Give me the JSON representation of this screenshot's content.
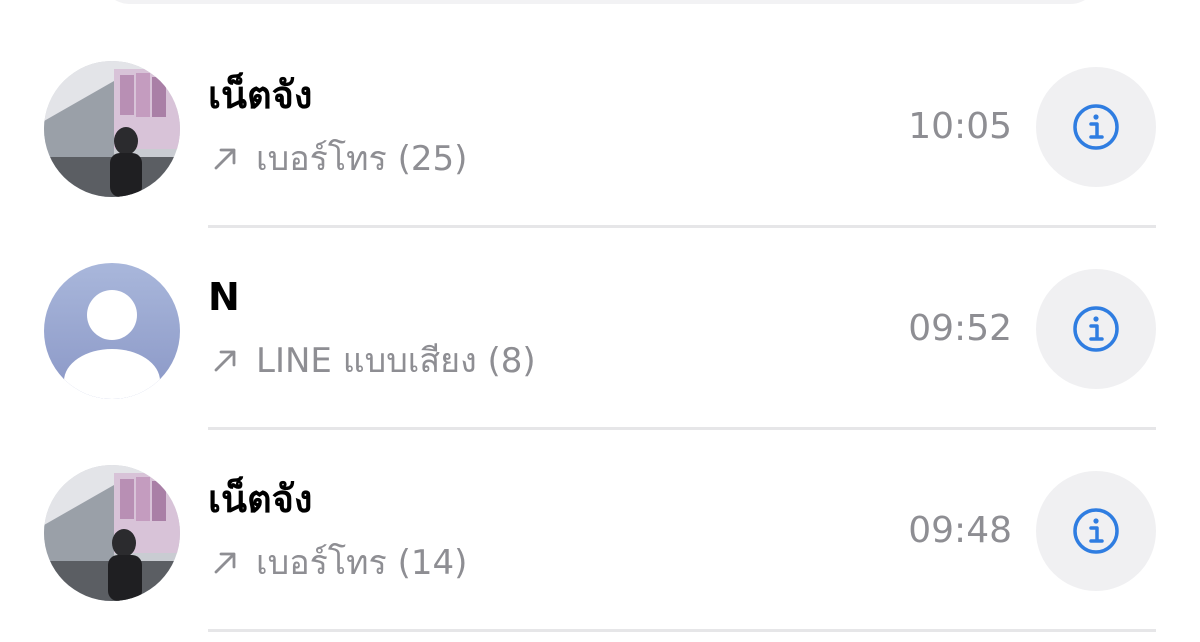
{
  "calls": [
    {
      "name": "เน็ตจัง",
      "call_type": "เบอร์โทร (25)",
      "time": "10:05",
      "avatar": "photo",
      "direction_icon": "outgoing-arrow-icon"
    },
    {
      "name": "N",
      "call_type": "LINE แบบเสียง (8)",
      "time": "09:52",
      "avatar": "placeholder",
      "direction_icon": "outgoing-arrow-icon"
    },
    {
      "name": "เน็ตจัง",
      "call_type": "เบอร์โทร (14)",
      "time": "09:48",
      "avatar": "photo",
      "direction_icon": "outgoing-arrow-icon"
    }
  ],
  "colors": {
    "accent": "#2f7de1",
    "secondary_text": "#8e8e93",
    "info_button_bg": "#f0f0f2",
    "divider": "#e6e6e8",
    "placeholder_avatar_top": "#a9b7db",
    "placeholder_avatar_bottom": "#8a97c6"
  },
  "icons": {
    "info": "info-circle-icon",
    "direction": "outgoing-arrow-icon"
  }
}
